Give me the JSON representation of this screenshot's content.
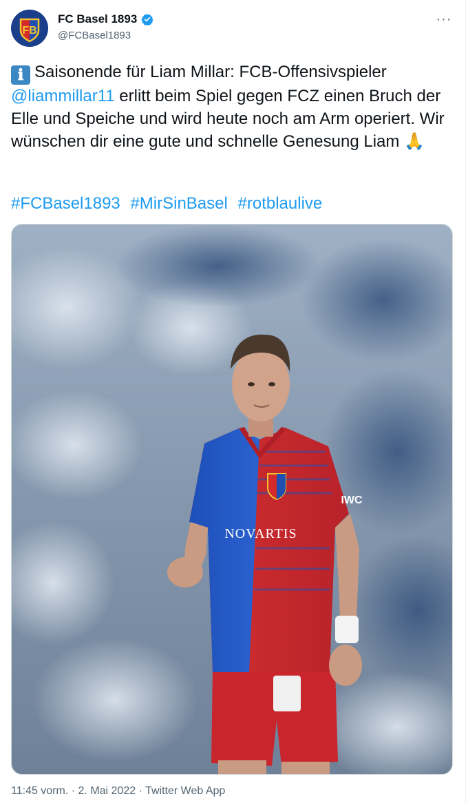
{
  "tweet": {
    "display_name": "FC Basel 1893",
    "handle": "@FCBasel1893",
    "more_label": "···",
    "info_emoji": "ℹ",
    "text_part1": "Saisonende für Liam Millar: FCB-Offensivspieler",
    "mention": "@liammillar11",
    "text_part2": "erlitt beim Spiel gegen FCZ einen Bruch der Elle und Speiche und wird heute noch am Arm operiert. Wir wünschen dir eine gute und schnelle Genesung Liam",
    "pray_emoji": "🙏",
    "hashtags": [
      "#FCBasel1893",
      "#MirSinBasel",
      "#rotblaulive"
    ]
  },
  "media": {
    "jersey_sponsor": "NOVARTIS",
    "jersey_sleeve": "IWC"
  },
  "footer": {
    "time": "11:45 vorm.",
    "sep1": "·",
    "date": "2. Mai 2022",
    "sep2": "·",
    "source": "Twitter Web App"
  },
  "colors": {
    "link": "#1d9bf0",
    "secondary_text": "#536471",
    "primary_text": "#0f1419",
    "jersey_blue": "#2456b8",
    "jersey_red": "#d72b2b"
  }
}
